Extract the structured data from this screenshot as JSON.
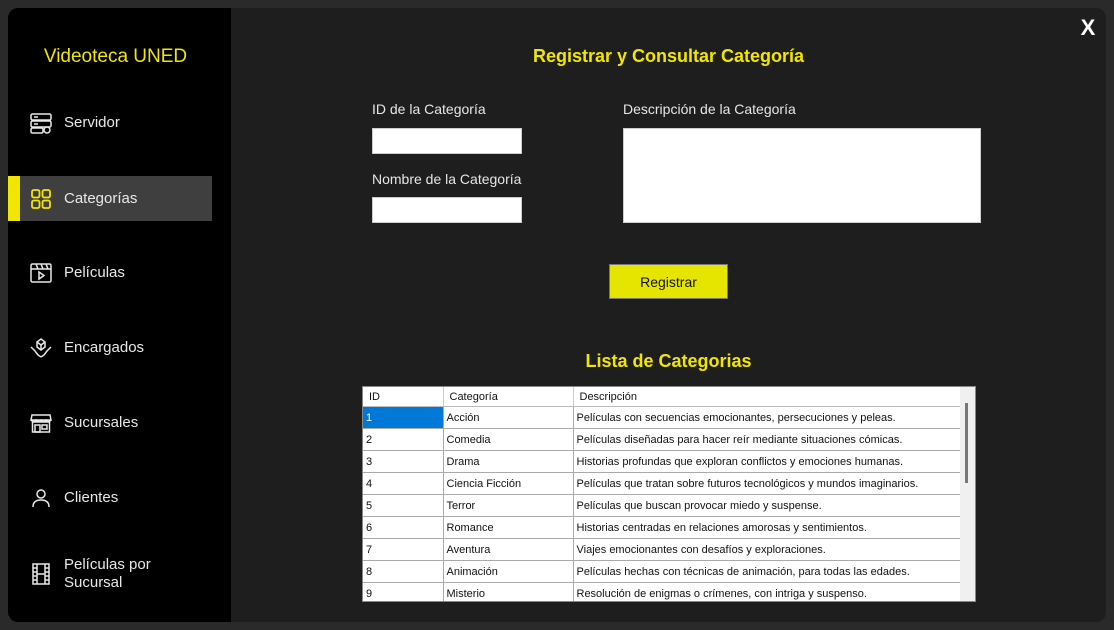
{
  "app": {
    "title": "Videoteca UNED",
    "close_label": "X"
  },
  "colors": {
    "accent": "#f2e600",
    "sidebar_bg": "#000000",
    "content_bg": "#1e1e1e",
    "selection": "#0078d7"
  },
  "sidebar": {
    "items": [
      {
        "label": "Servidor",
        "icon": "server-icon"
      },
      {
        "label": "Categorías",
        "icon": "grid-icon",
        "active": true
      },
      {
        "label": "Películas",
        "icon": "clapperboard-icon"
      },
      {
        "label": "Encargados",
        "icon": "hands-box-icon"
      },
      {
        "label": "Sucursales",
        "icon": "store-icon"
      },
      {
        "label": "Clientes",
        "icon": "user-icon"
      },
      {
        "label": "Películas por Sucursal",
        "icon": "film-strip-icon"
      }
    ]
  },
  "form": {
    "title": "Registrar y Consultar Categoría",
    "id_label": "ID de la Categoría",
    "id_value": "",
    "name_label": "Nombre de la Categoría",
    "name_value": "",
    "description_label": "Descripción de la Categoría",
    "description_value": "",
    "register_label": "Registrar"
  },
  "list": {
    "title": "Lista de Categorias",
    "columns": [
      "ID",
      "Categoría",
      "Descripción"
    ],
    "rows": [
      [
        "1",
        "Acción",
        "Películas con secuencias emocionantes, persecuciones y peleas."
      ],
      [
        "2",
        "Comedia",
        "Películas diseñadas para hacer reír mediante situaciones cómicas."
      ],
      [
        "3",
        "Drama",
        "Historias profundas que exploran conflictos y emociones humanas."
      ],
      [
        "4",
        "Ciencia Ficción",
        "Películas que tratan sobre futuros tecnológicos y mundos imaginarios."
      ],
      [
        "5",
        "Terror",
        "Películas que buscan provocar miedo y suspense."
      ],
      [
        "6",
        "Romance",
        "Historias centradas en relaciones amorosas y sentimientos."
      ],
      [
        "7",
        "Aventura",
        "Viajes emocionantes con desafíos y exploraciones."
      ],
      [
        "8",
        "Animación",
        "Películas hechas con técnicas de animación, para todas las edades."
      ],
      [
        "9",
        "Misterio",
        "Resolución de enigmas o crímenes, con intriga y suspenso."
      ]
    ]
  }
}
